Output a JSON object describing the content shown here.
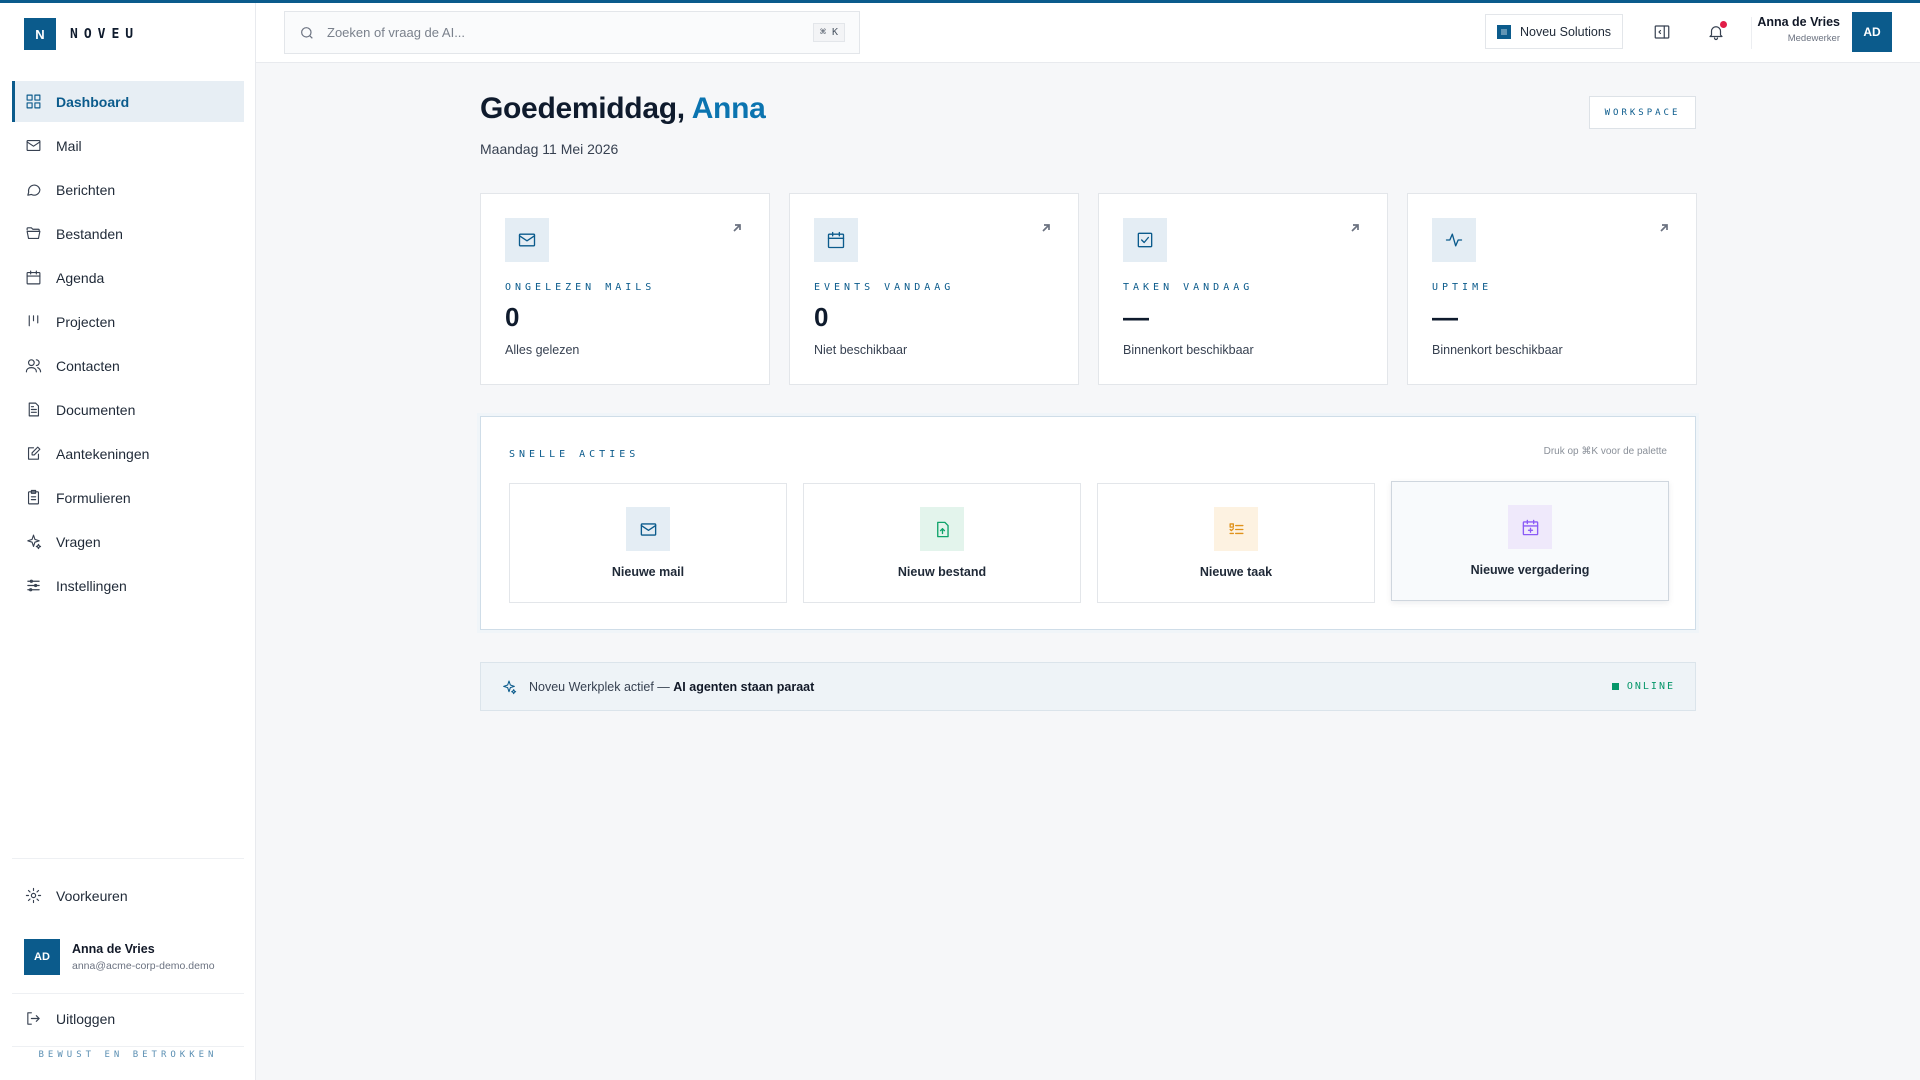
{
  "brand": {
    "logo_letter": "N",
    "name": "NOVEU"
  },
  "sidebar": {
    "items": [
      {
        "label": "Dashboard",
        "icon": "dashboard-icon",
        "active": true
      },
      {
        "label": "Mail",
        "icon": "mail-icon"
      },
      {
        "label": "Berichten",
        "icon": "message-icon"
      },
      {
        "label": "Bestanden",
        "icon": "folder-icon"
      },
      {
        "label": "Agenda",
        "icon": "calendar-icon"
      },
      {
        "label": "Projecten",
        "icon": "kanban-icon"
      },
      {
        "label": "Contacten",
        "icon": "users-icon"
      },
      {
        "label": "Documenten",
        "icon": "document-icon"
      },
      {
        "label": "Aantekeningen",
        "icon": "note-edit-icon"
      },
      {
        "label": "Formulieren",
        "icon": "clipboard-icon"
      },
      {
        "label": "Vragen",
        "icon": "sparkles-icon"
      },
      {
        "label": "Instellingen",
        "icon": "sliders-icon"
      }
    ],
    "preferences_label": "Voorkeuren",
    "user": {
      "initials": "AD",
      "name": "Anna de Vries",
      "email": "anna@acme-corp-demo.demo"
    },
    "logout_label": "Uitloggen",
    "tagline": "BEWUST EN BETROKKEN"
  },
  "topbar": {
    "search": {
      "placeholder": "Zoeken of vraag de AI...",
      "shortcut": "⌘ K"
    },
    "org_label": "Noveu Solutions",
    "user": {
      "name": "Anna de Vries",
      "role": "Medewerker",
      "initials": "AD"
    }
  },
  "main": {
    "greeting_prefix": "Goedemiddag,",
    "greeting_name": "Anna",
    "date": "Maandag 11 Mei 2026",
    "workspace_badge": "WORKSPACE",
    "stats": [
      {
        "label": "ONGELEZEN MAILS",
        "value": "0",
        "sub": "Alles gelezen",
        "icon": "mail-icon"
      },
      {
        "label": "EVENTS VANDAAG",
        "value": "0",
        "sub": "Niet beschikbaar",
        "icon": "calendar-icon"
      },
      {
        "label": "TAKEN VANDAAG",
        "value": "—",
        "sub": "Binnenkort beschikbaar",
        "icon": "checkbox-icon"
      },
      {
        "label": "UPTIME",
        "value": "—",
        "sub": "Binnenkort beschikbaar",
        "icon": "activity-icon"
      }
    ],
    "quick_actions": {
      "title": "SNELLE ACTIES",
      "hint": "Druk op ⌘K voor de palette",
      "items": [
        {
          "label": "Nieuwe mail",
          "icon": "mail-icon",
          "color": "#0b5b8c",
          "bg": "#e4edf4"
        },
        {
          "label": "Nieuw bestand",
          "icon": "file-upload-icon",
          "color": "#10a36b",
          "bg": "#e3f4ec"
        },
        {
          "label": "Nieuwe taak",
          "icon": "task-list-icon",
          "color": "#e0921a",
          "bg": "#fdf2e1"
        },
        {
          "label": "Nieuwe vergadering",
          "icon": "calendar-plus-icon",
          "color": "#8b5cf6",
          "bg": "#efe9fb"
        }
      ]
    },
    "status": {
      "text": "Noveu Werkplek actief —",
      "highlight": "AI agenten staan paraat",
      "online_label": "ONLINE"
    }
  },
  "colors": {
    "primary": "#0b5b8c",
    "accent_name": "#0b74b0",
    "online": "#059669"
  }
}
